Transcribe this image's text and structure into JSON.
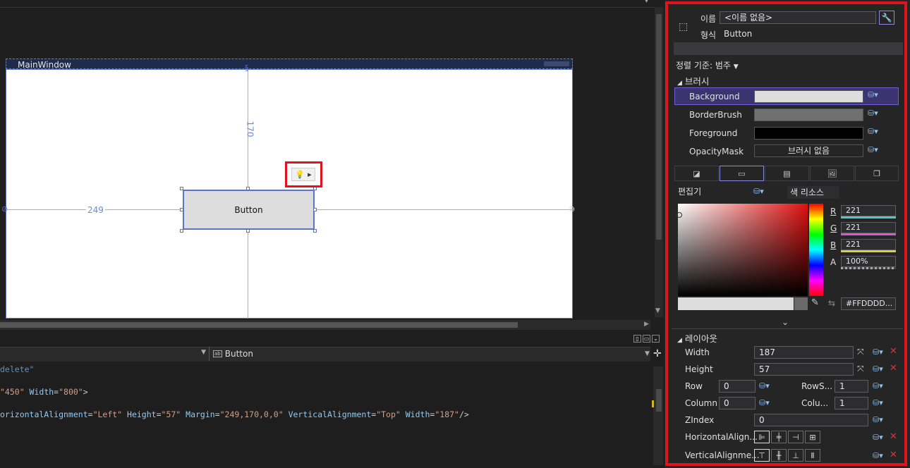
{
  "designer": {
    "window_title": "MainWindow",
    "top_margin_label": "170",
    "left_margin_label": "249",
    "button_label": "Button"
  },
  "editor": {
    "element_dropdown": "Button",
    "lines": [
      {
        "parts": [
          {
            "cls": "g",
            "text": "delete\""
          }
        ]
      },
      {
        "parts": [
          {
            "cls": "s",
            "text": "\"450\""
          },
          {
            "cls": "a",
            "text": " Width"
          },
          {
            "cls": "p",
            "text": "="
          },
          {
            "cls": "s",
            "text": "\"800\""
          },
          {
            "cls": "p",
            "text": ">"
          }
        ]
      },
      {
        "parts": [
          {
            "cls": "a",
            "text": "orizontalAlignment"
          },
          {
            "cls": "p",
            "text": "="
          },
          {
            "cls": "s",
            "text": "\"Left\""
          },
          {
            "cls": "a",
            "text": " Height"
          },
          {
            "cls": "p",
            "text": "="
          },
          {
            "cls": "s",
            "text": "\"57\""
          },
          {
            "cls": "a",
            "text": " Margin"
          },
          {
            "cls": "p",
            "text": "="
          },
          {
            "cls": "s",
            "text": "\"249,170,0,0\""
          },
          {
            "cls": "a",
            "text": " VerticalAlignment"
          },
          {
            "cls": "p",
            "text": "="
          },
          {
            "cls": "s",
            "text": "\"Top\""
          },
          {
            "cls": "a",
            "text": " Width"
          },
          {
            "cls": "p",
            "text": "="
          },
          {
            "cls": "s",
            "text": "\"187\""
          },
          {
            "cls": "p",
            "text": "/>"
          }
        ]
      }
    ]
  },
  "props": {
    "name_label": "이름",
    "name_value": "<이름 없음>",
    "type_label": "형식",
    "type_value": "Button",
    "sort_label": "정렬 기준: 범주",
    "brush_section": "브러시",
    "brushes": [
      {
        "name": "Background",
        "color": "#dddddd",
        "text": ""
      },
      {
        "name": "BorderBrush",
        "color": "#707070",
        "text": ""
      },
      {
        "name": "Foreground",
        "color": "#000000",
        "text": ""
      },
      {
        "name": "OpacityMask",
        "color": "#252526",
        "text": "브러시 없음"
      }
    ],
    "editor_label": "편집기",
    "color_resource_label": "색 리소스",
    "rgba": [
      {
        "label": "R",
        "value": "221",
        "color": "#4ec9c4"
      },
      {
        "label": "G",
        "value": "221",
        "color": "#d05ad0"
      },
      {
        "label": "B",
        "value": "221",
        "color": "#d8d040"
      },
      {
        "label": "A",
        "value": "100%",
        "color": "#aaaaaa"
      }
    ],
    "hex_value": "#FFDDDD...",
    "layout_section": "레이아웃",
    "width_label": "Width",
    "width_value": "187",
    "height_label": "Height",
    "height_value": "57",
    "row_label": "Row",
    "row_value": "0",
    "rowspan_label": "RowS...",
    "rowspan_value": "1",
    "column_label": "Column",
    "column_value": "0",
    "colspan_label": "Colu...",
    "colspan_value": "1",
    "zindex_label": "ZIndex",
    "zindex_value": "0",
    "halign_label": "HorizontalAlign...",
    "valign_label": "VerticalAlignme..."
  }
}
